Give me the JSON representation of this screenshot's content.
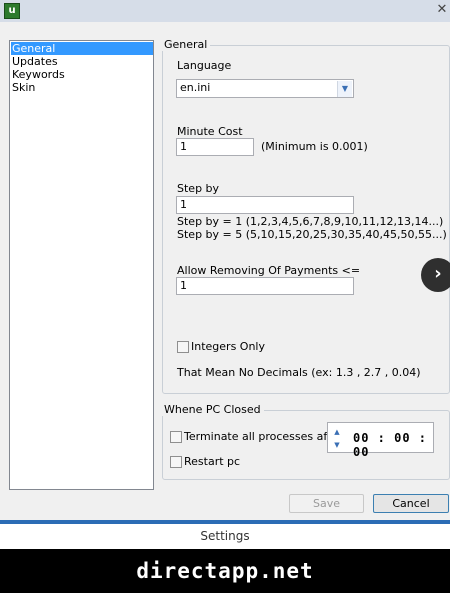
{
  "window": {
    "app_icon_glyph": "u",
    "close_glyph": "✕"
  },
  "nav": {
    "items": [
      {
        "label": "General",
        "selected": true
      },
      {
        "label": "Updates",
        "selected": false
      },
      {
        "label": "Keywords",
        "selected": false
      },
      {
        "label": "Skin",
        "selected": false
      }
    ]
  },
  "general": {
    "group_title": "General",
    "language": {
      "label": "Language",
      "value": "en.ini"
    },
    "minute_cost": {
      "label": "Minute Cost",
      "value": "1",
      "hint": "(Minimum is 0.001)"
    },
    "step_by": {
      "label": "Step by",
      "value": "1",
      "example1": "Step by = 1 (1,2,3,4,5,6,7,8,9,10,11,12,13,14...)",
      "example2": "Step by = 5 (5,10,15,20,25,30,35,40,45,50,55...)"
    },
    "allow_removing": {
      "label": "Allow Removing Of Payments <=",
      "value": "1"
    },
    "integers_only": {
      "label": "Integers Only",
      "checked": false,
      "note": "That Mean No Decimals (ex: 1.3 , 2.7 , 0.04)"
    }
  },
  "pc_closed": {
    "group_title": "Whene PC Closed",
    "terminate": {
      "label": "Terminate all processes after",
      "checked": false
    },
    "restart": {
      "label": "Restart pc",
      "checked": false
    },
    "time": "00 : 00 : 00"
  },
  "buttons": {
    "save": "Save",
    "cancel": "Cancel"
  },
  "caption": "Settings",
  "watermark": "directapp.net",
  "icons": {
    "next": "chevron-right-icon"
  }
}
